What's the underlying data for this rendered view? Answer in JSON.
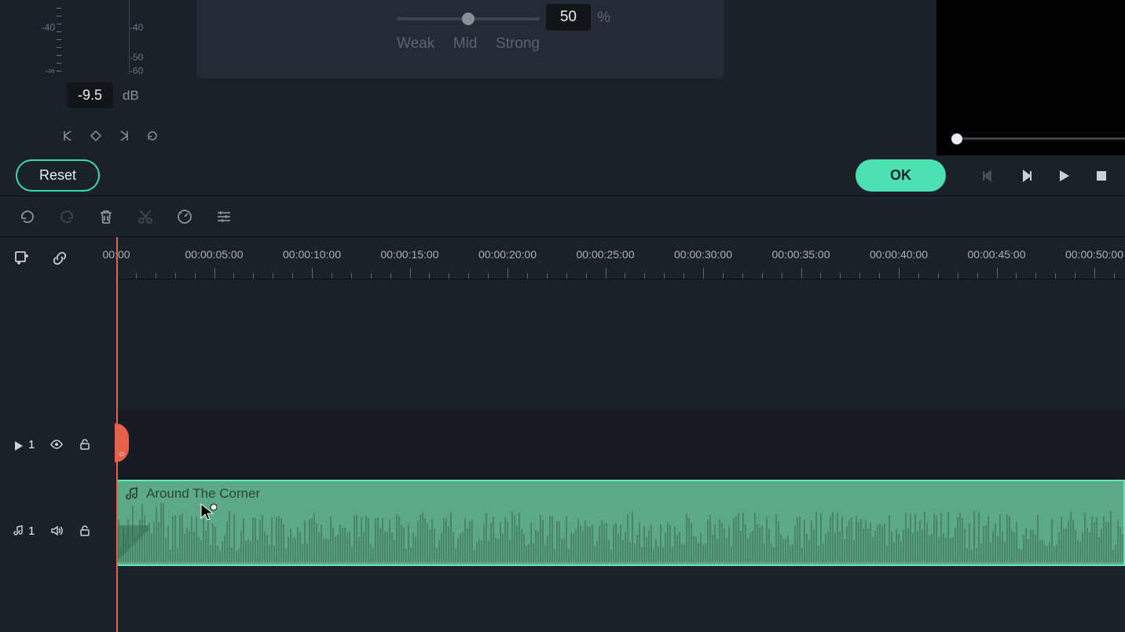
{
  "meter": {
    "left_labels": [
      "-40",
      "-∞"
    ],
    "right_labels": [
      "-40",
      "-50",
      "-60"
    ],
    "db_value": "-9.5",
    "db_unit": "dB"
  },
  "slider": {
    "weak": "Weak",
    "mid": "Mid",
    "strong": "Strong",
    "value": "50",
    "unit": "%"
  },
  "buttons": {
    "reset": "Reset",
    "ok": "OK"
  },
  "ruler": {
    "labels": [
      "00:00",
      "00:00:05:00",
      "00:00:10:00",
      "00:00:15:00",
      "00:00:20:00",
      "00:00:25:00",
      "00:00:30:00",
      "00:00:35:00",
      "00:00:40:00",
      "00:00:45:00",
      "00:00:50:00"
    ]
  },
  "tracks": {
    "video": {
      "label": "1"
    },
    "audio": {
      "label": "1",
      "clip_name": "Around The Corner"
    }
  }
}
